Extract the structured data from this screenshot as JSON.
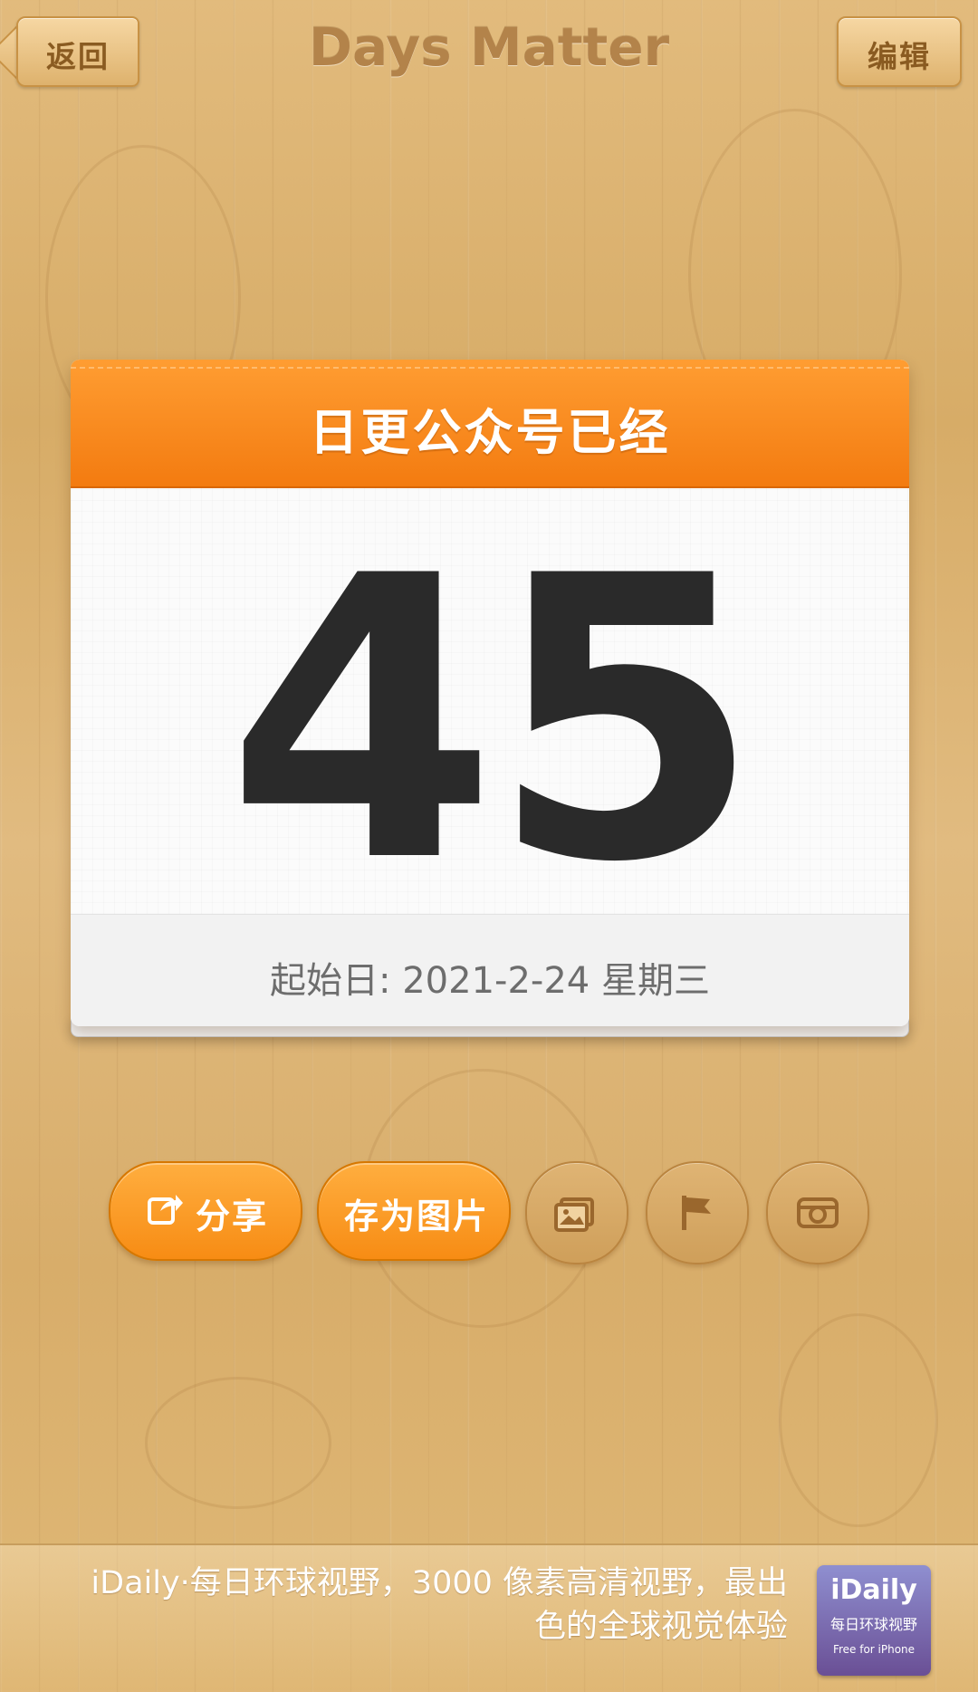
{
  "header": {
    "back_label": "返回",
    "app_title": "Days Matter",
    "edit_label": "编辑"
  },
  "card": {
    "title": "日更公众号已经",
    "day_count": "45",
    "start_date_text": "起始日: 2021-2-24 星期三"
  },
  "actions": {
    "share_label": "分享",
    "save_image_label": "存为图片",
    "icon_buttons": [
      "photo-icon",
      "flag-icon",
      "camera-icon"
    ]
  },
  "ad": {
    "line1": "iDaily·每日环球视野，3000 像素高清视野，最出",
    "line2": "色的全球视觉体验",
    "logo_line1": "iDaily",
    "logo_line2": "每日环球视野",
    "logo_line3": "Free for iPhone"
  },
  "colors": {
    "accent_orange": "#F78C14",
    "wood": "#D9AE6C",
    "number_text": "#2A2A2A"
  }
}
